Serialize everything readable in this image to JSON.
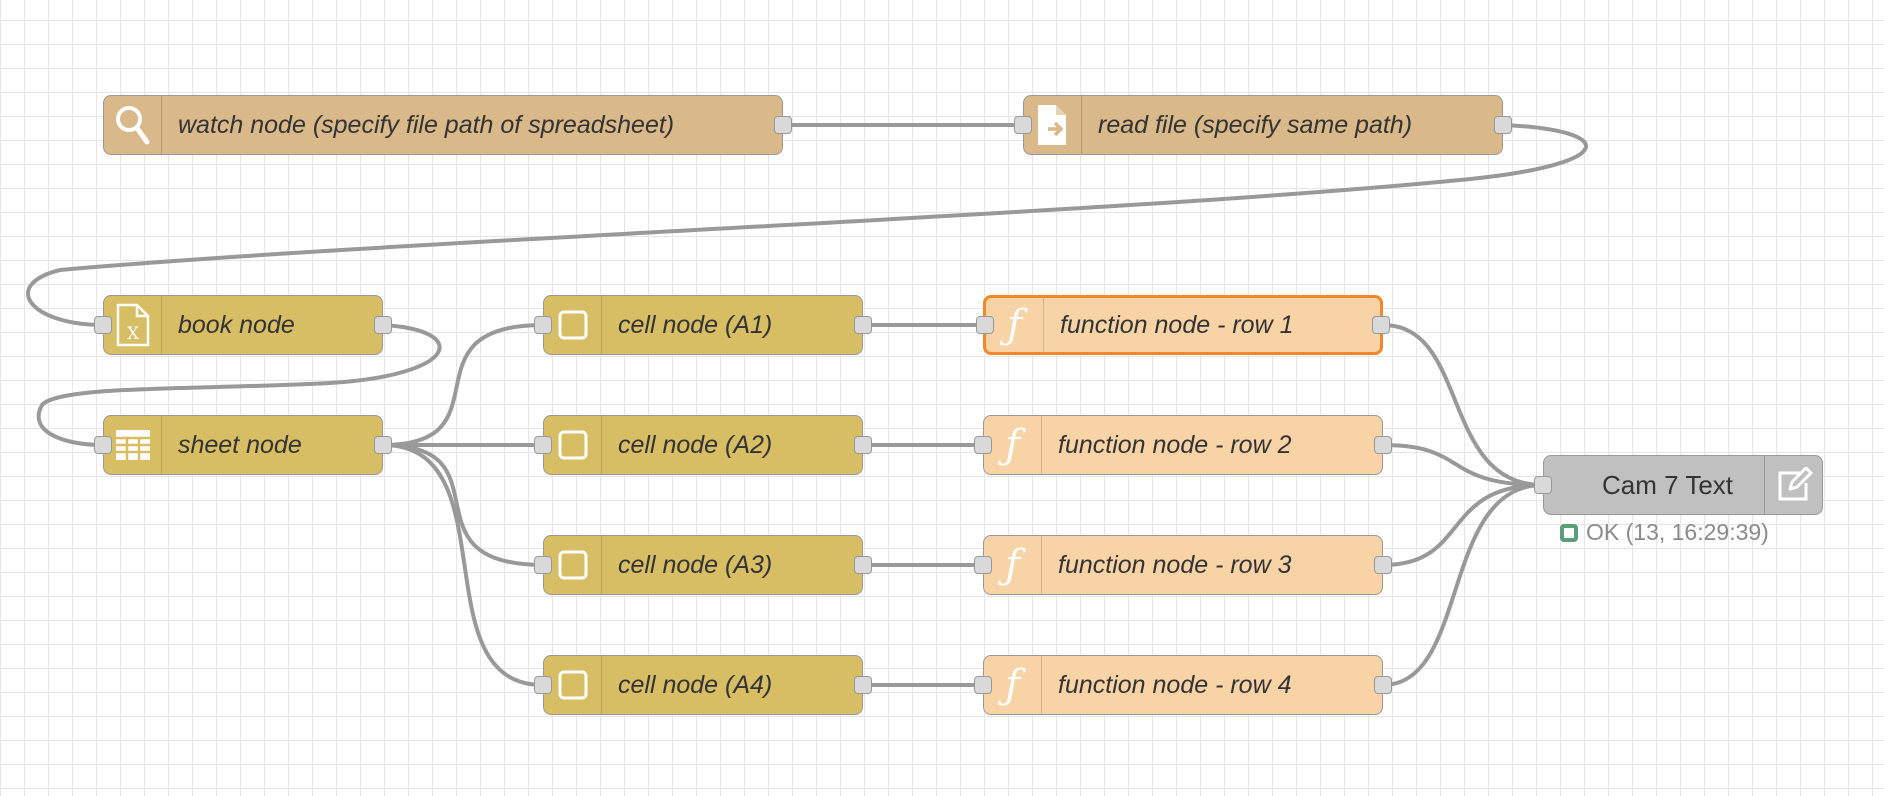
{
  "flow": {
    "nodes": {
      "watch": {
        "label": "watch node (specify file path of spreadsheet)",
        "icon": "search-icon"
      },
      "read": {
        "label": "read file (specify same path)",
        "icon": "file-in-icon"
      },
      "book": {
        "label": "book node",
        "icon": "excel-file-icon"
      },
      "sheet": {
        "label": "sheet node",
        "icon": "table-icon"
      },
      "cells": [
        {
          "label": "cell node (A1)",
          "icon": "square-icon"
        },
        {
          "label": "cell node (A2)",
          "icon": "square-icon"
        },
        {
          "label": "cell node (A3)",
          "icon": "square-icon"
        },
        {
          "label": "cell node (A4)",
          "icon": "square-icon"
        }
      ],
      "functions": [
        {
          "label": "function node - row 1",
          "icon": "function-icon"
        },
        {
          "label": "function node - row 2",
          "icon": "function-icon"
        },
        {
          "label": "function node - row 3",
          "icon": "function-icon"
        },
        {
          "label": "function node - row 4",
          "icon": "function-icon"
        }
      ],
      "cam": {
        "label": "Cam 7 Text",
        "icon": "edit-icon",
        "status": "OK (13, 16:29:39)",
        "status_color": "#5a9e7c"
      }
    },
    "colors": {
      "tan": "#d9b88a",
      "gold": "#d7bd63",
      "peach": "#f7d3a6",
      "grey": "#c0c0c0",
      "selected": "#f2882e",
      "wire": "#999999"
    }
  }
}
